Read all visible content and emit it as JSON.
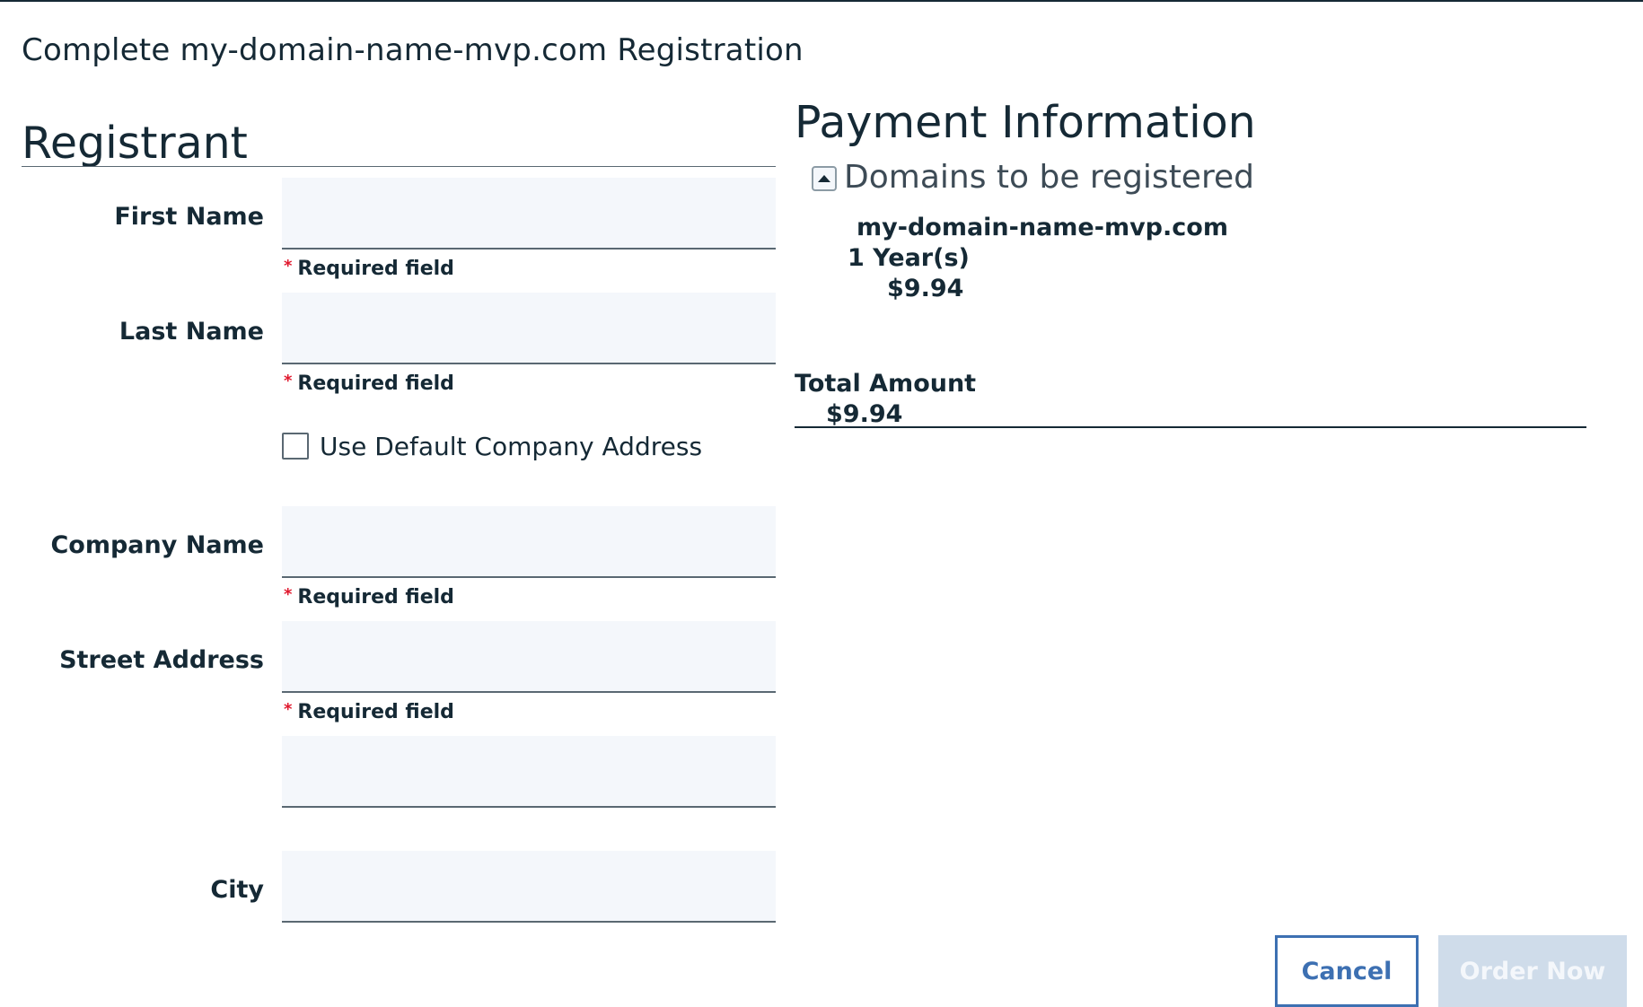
{
  "dialog": {
    "title": "Complete my-domain-name-mvp.com Registration"
  },
  "registrant": {
    "heading": "Registrant",
    "fields": {
      "first_name": {
        "label": "First Name",
        "value": "",
        "required_text": "Required field"
      },
      "last_name": {
        "label": "Last Name",
        "value": "",
        "required_text": "Required field"
      },
      "company_name": {
        "label": "Company Name",
        "value": "",
        "required_text": "Required field"
      },
      "street_address": {
        "label": "Street Address",
        "value": "",
        "required_text": "Required field"
      },
      "street_address_2": {
        "label": "",
        "value": ""
      },
      "city": {
        "label": "City",
        "value": ""
      }
    },
    "default_address_checkbox": {
      "label": "Use Default Company Address",
      "checked": false
    }
  },
  "payment": {
    "heading": "Payment Information",
    "domains_section": {
      "label": "Domains to be registered",
      "expanded": true,
      "items": [
        {
          "domain": "my-domain-name-mvp.com",
          "term": "1 Year(s)",
          "price": "$9.94"
        }
      ]
    },
    "total_label": "Total Amount",
    "total_value": "$9.94"
  },
  "actions": {
    "cancel_label": "Cancel",
    "order_label": "Order Now",
    "order_enabled": false
  },
  "colors": {
    "text": "#152935",
    "accent": "#3d70b2",
    "required_star": "#e0182d",
    "input_bg": "#f4f7fb",
    "disabled_button_bg": "#cfdcea"
  }
}
